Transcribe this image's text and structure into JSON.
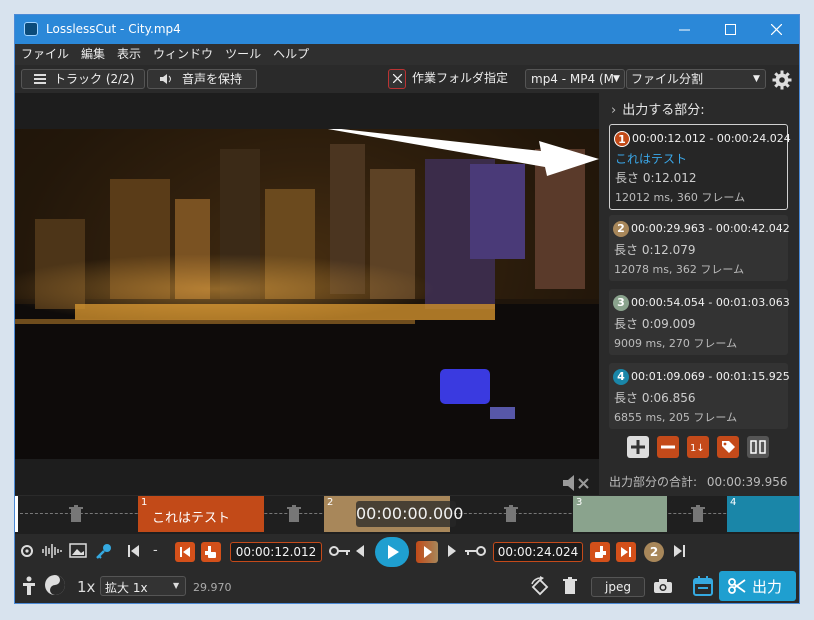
{
  "window": {
    "title": "LosslessCut - City.mp4"
  },
  "menu": [
    "ファイル",
    "編集",
    "表示",
    "ウィンドウ",
    "ツール",
    "ヘルプ"
  ],
  "toolbar": {
    "tracks_label": "トラック (2/2)",
    "keep_audio_label": "音声を保持",
    "workdir_label": "作業フォルダ指定",
    "format_value": "mp4 - MP4 (M",
    "mode_value": "ファイル分割"
  },
  "panel": {
    "heading": "出力する部分:",
    "segments": [
      {
        "num": "1",
        "times": "00:00:12.012 - 00:00:24.024",
        "name": "これはテスト",
        "length": "長さ 0:12.012",
        "info": "12012 ms, 360 フレーム",
        "color": "#c24a18"
      },
      {
        "num": "2",
        "times": "00:00:29.963 - 00:00:42.042",
        "length": "長さ 0:12.079",
        "info": "12078 ms, 362 フレーム",
        "color": "#a8875a"
      },
      {
        "num": "3",
        "times": "00:00:54.054 - 00:01:03.063",
        "length": "長さ 0:09.009",
        "info": "9009 ms, 270 フレーム",
        "color": "#8aa38d"
      },
      {
        "num": "4",
        "times": "00:01:09.069 - 00:01:15.925",
        "length": "長さ 0:06.856",
        "info": "6855 ms, 205 フレーム",
        "color": "#1a86a8"
      }
    ],
    "total_label": "出力部分の合計:",
    "total_value": "00:00:39.956"
  },
  "timeline": {
    "seg1_num": "1",
    "seg1_label": "これはテスト",
    "seg2_num": "2",
    "seg3_num": "3",
    "seg4_num": "4",
    "current_time": "00:00:00.000"
  },
  "controls": {
    "dash": "-",
    "start_time": "00:00:12.012",
    "end_time": "00:00:24.024",
    "seg_badge": "2"
  },
  "bottom": {
    "speed": "1x",
    "zoom_value": "拡大 1x",
    "fps": "29.970",
    "capture_format": "jpeg",
    "export_label": "出力"
  }
}
